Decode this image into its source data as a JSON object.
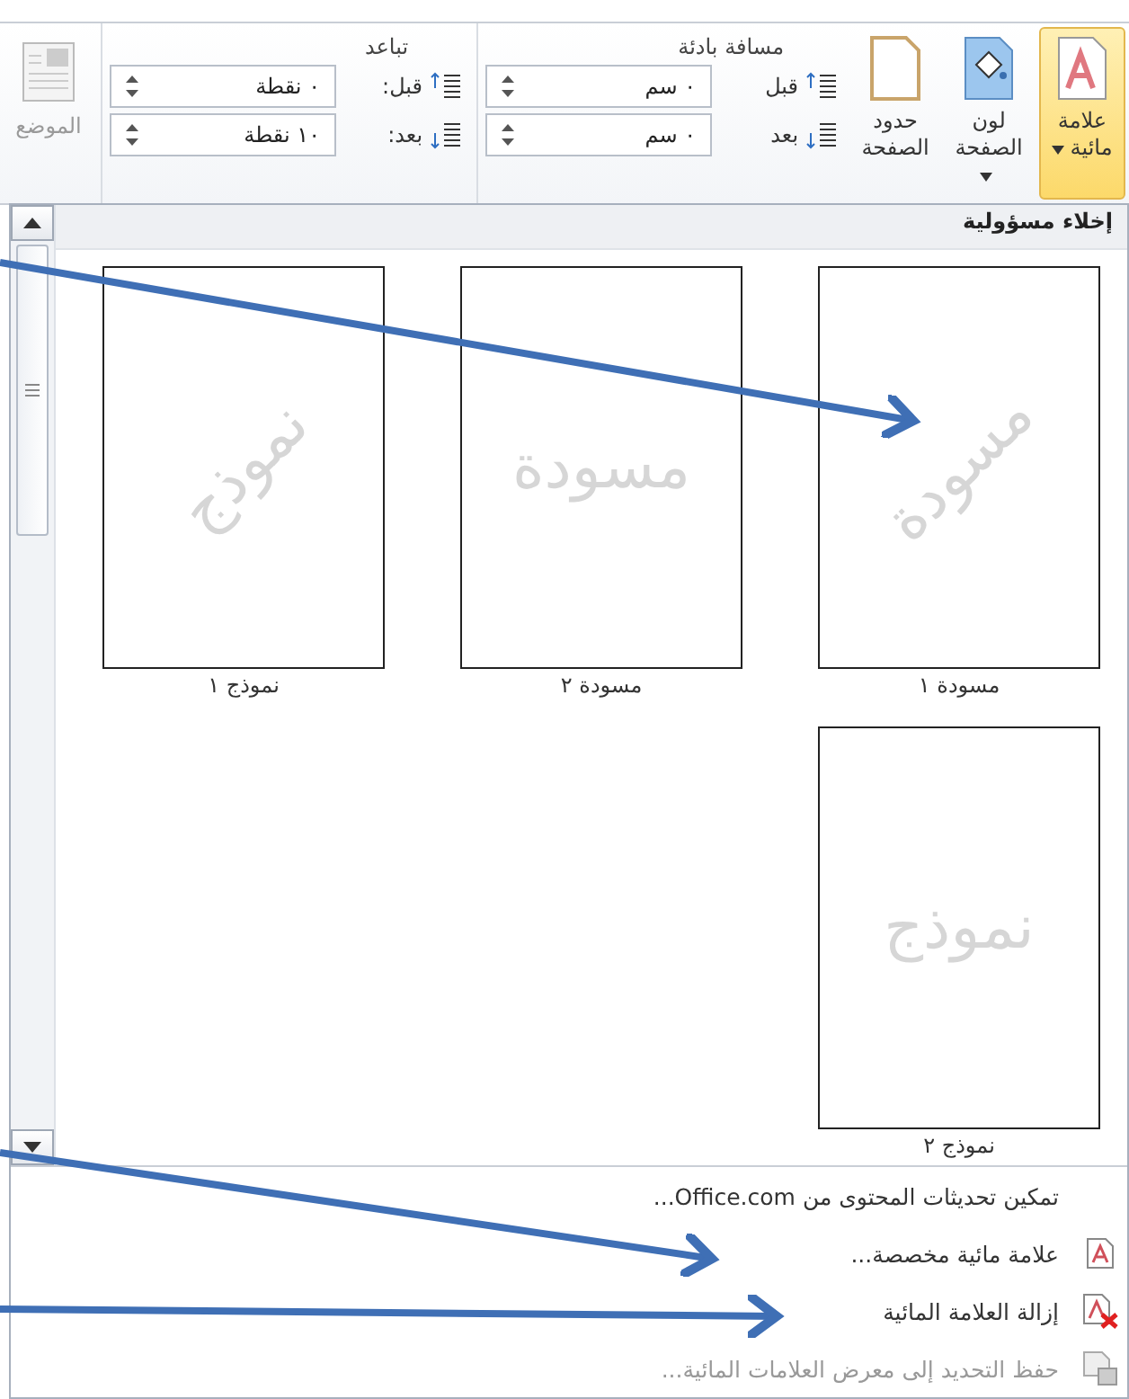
{
  "ribbon": {
    "buttons": [
      {
        "kind": "watermark",
        "label": "علامة مائية",
        "dropdown": true,
        "selected": true
      },
      {
        "kind": "page-color",
        "label": "لون الصفحة",
        "dropdown": true,
        "selected": false
      },
      {
        "kind": "page-borders",
        "label": "حدود الصفحة",
        "dropdown": false,
        "selected": false
      }
    ],
    "indent": {
      "title": "مسافة بادئة",
      "rows": [
        {
          "kind": "before",
          "label": "قبل",
          "value": "٠ سم"
        },
        {
          "kind": "after",
          "label": "بعد",
          "value": "٠ سم"
        }
      ]
    },
    "spacing": {
      "title": "تباعد",
      "rows": [
        {
          "kind": "before",
          "label": "قبل:",
          "value": "٠ نقطة"
        },
        {
          "kind": "after",
          "label": "بعد:",
          "value": "١٠ نقطة"
        }
      ]
    },
    "position": {
      "label": "الموضع",
      "disabled": true
    }
  },
  "gallery": {
    "heading": "إخلاء مسؤولية",
    "rows": [
      [
        {
          "watermark": "مسودة",
          "kind": "diagonal",
          "label": "مسودة ١"
        },
        {
          "watermark": "مسودة",
          "kind": "horizontal",
          "label": "مسودة ٢"
        },
        {
          "watermark": "نموذج",
          "kind": "diagonal",
          "label": "نموذج ١"
        }
      ],
      [
        {
          "watermark": "نموذج",
          "kind": "horizontal",
          "label": "نموذج ٢"
        }
      ]
    ]
  },
  "menu": [
    {
      "kind": "text",
      "label": "تمكين تحديثات المحتوى من Office.com...",
      "disabled": false
    },
    {
      "kind": "custom",
      "label": "علامة مائية مخصصة...",
      "disabled": false
    },
    {
      "kind": "remove",
      "label": "إزالة العلامة المائية",
      "disabled": false
    },
    {
      "kind": "save",
      "label": "حفظ التحديد إلى معرض العلامات المائية...",
      "disabled": true
    }
  ]
}
